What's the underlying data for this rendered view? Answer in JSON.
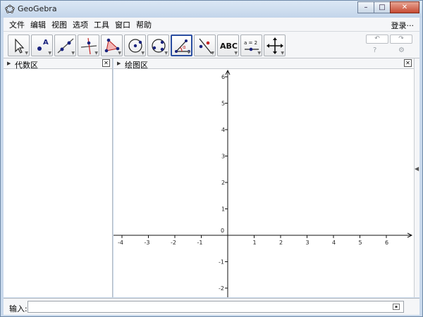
{
  "window": {
    "title": "GeoGebra",
    "minimize": "–",
    "maximize": "□",
    "close": "✕"
  },
  "menu": [
    "文件",
    "编辑",
    "视图",
    "选项",
    "工具",
    "窗口",
    "帮助"
  ],
  "login": "登录···",
  "toolbar": {
    "text_tool": "ABC",
    "slider_tool": "a = 2",
    "undo": "↶",
    "redo": "↷",
    "help": "?",
    "settings": "⚙"
  },
  "algebra_view": {
    "title": "代数区",
    "close": "✕"
  },
  "graphics_view": {
    "title": "绘图区",
    "close": "✕"
  },
  "axes": {
    "x_ticks": [
      "-4",
      "-3",
      "-2",
      "-1",
      "0",
      "1",
      "2",
      "3",
      "4",
      "5",
      "6"
    ],
    "y_ticks": [
      "6",
      "5",
      "4",
      "3",
      "2",
      "1",
      "-1",
      "-2"
    ]
  },
  "input_bar": {
    "label": "输入:",
    "value": "",
    "placeholder": ""
  },
  "colors": {
    "accent": "#2a4da0",
    "point": "#1a237e",
    "background": "#ffffff"
  }
}
